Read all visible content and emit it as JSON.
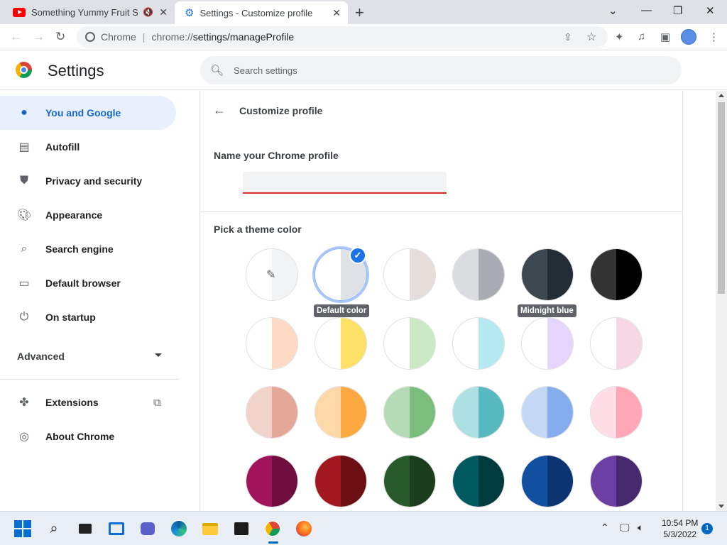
{
  "tabs": [
    {
      "title": "Something Yummy Fruit Son",
      "icon": "youtube-icon",
      "muted": true
    },
    {
      "title": "Settings - Customize profile",
      "icon": "gear-icon",
      "active": true
    }
  ],
  "address": {
    "host": "Chrome",
    "url_prefix": "chrome://",
    "url_path": "settings/manageProfile"
  },
  "header": {
    "title": "Settings",
    "search_placeholder": "Search settings"
  },
  "sidebar": {
    "items": [
      {
        "label": "You and Google",
        "icon": "person-icon",
        "active": true
      },
      {
        "label": "Autofill",
        "icon": "clipboard-icon"
      },
      {
        "label": "Privacy and security",
        "icon": "shield-icon"
      },
      {
        "label": "Appearance",
        "icon": "palette-icon"
      },
      {
        "label": "Search engine",
        "icon": "search-icon"
      },
      {
        "label": "Default browser",
        "icon": "browser-icon"
      },
      {
        "label": "On startup",
        "icon": "power-icon"
      }
    ],
    "advanced_label": "Advanced",
    "extensions_label": "Extensions",
    "about_label": "About Chrome"
  },
  "main": {
    "title": "Customize profile",
    "name_label": "Name your Chrome profile",
    "name_value": "",
    "theme_label": "Pick a theme color",
    "selected_theme": "Default color",
    "tooltips": {
      "default": "Default color",
      "hover": "Midnight blue"
    },
    "swatches": [
      [
        "#ffffff",
        "#f1f3f4"
      ],
      [
        "#ffffff",
        "#dee1e6"
      ],
      [
        "#ffffff",
        "#e6dcd9"
      ],
      [
        "#dadce0",
        "#a9acb4"
      ],
      [
        "#3c4750",
        "#232d35"
      ],
      [
        "#333333",
        "#000000"
      ],
      [
        "#ffffff",
        "#fdd9c6"
      ],
      [
        "#ffffff",
        "#fde068"
      ],
      [
        "#ffffff",
        "#cce9c5"
      ],
      [
        "#ffffff",
        "#b5e8f0"
      ],
      [
        "#ffffff",
        "#e5d5fc"
      ],
      [
        "#ffffff",
        "#f7d7e3"
      ],
      [
        "#f1d3cb",
        "#e3a898"
      ],
      [
        "#fdd9a9",
        "#fca942"
      ],
      [
        "#b4dbb5",
        "#7bbd7c"
      ],
      [
        "#ade0e2",
        "#58b9c1"
      ],
      [
        "#c4d8f6",
        "#85aded"
      ],
      [
        "#ffdde5",
        "#ffa7b7"
      ],
      [
        "#a1145c",
        "#6f0d3e"
      ],
      [
        "#a31720",
        "#6b0f15"
      ],
      [
        "#285a2b",
        "#1b3c1d"
      ],
      [
        "#005a5f",
        "#003b3e"
      ],
      [
        "#114fa0",
        "#0b3470"
      ],
      [
        "#6b3fa3",
        "#47296d"
      ]
    ]
  },
  "taskbar": {
    "time": "10:54 PM",
    "date": "5/3/2022",
    "notification_count": "1"
  }
}
